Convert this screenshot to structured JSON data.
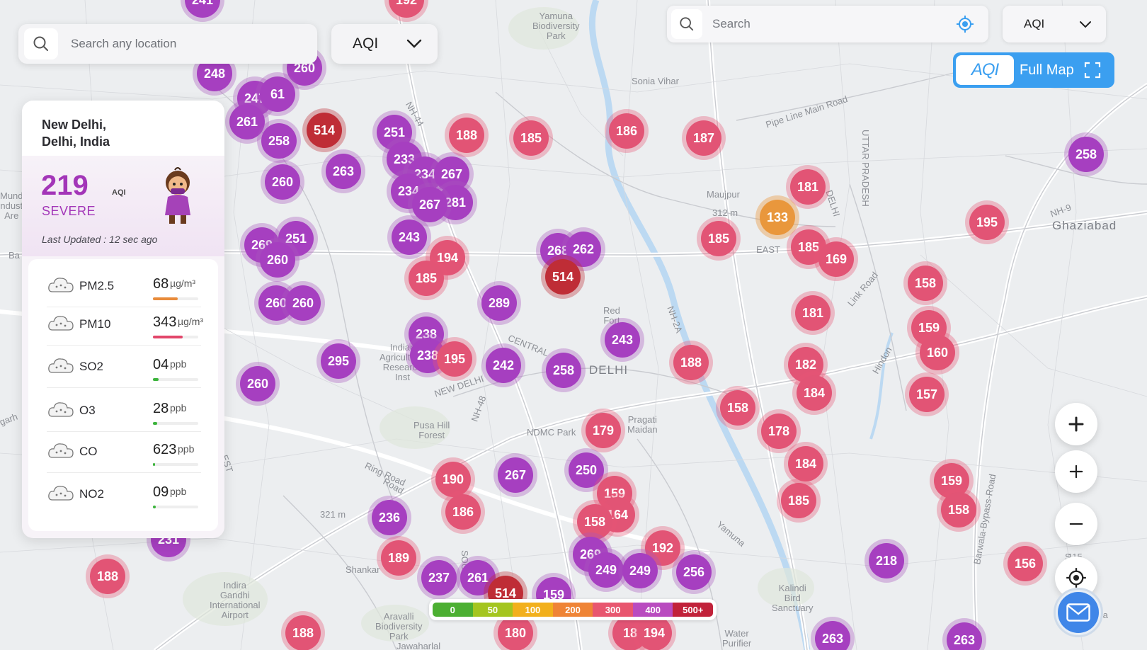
{
  "search": {
    "placeholder": "Search any location"
  },
  "selector": {
    "value": "AQI"
  },
  "location": {
    "line1": "New Delhi,",
    "line2": "Delhi, India"
  },
  "current": {
    "aqi": "219",
    "unit": "AQI",
    "level": "SEVERE",
    "updated": "Last Updated : 12 sec ago"
  },
  "pollutants": [
    {
      "name": "PM2.5",
      "value": "68",
      "unit": "µg/m³",
      "fill": 0.55,
      "color": "#e88b3a",
      "icon": "pm25-cloud-icon"
    },
    {
      "name": "PM10",
      "value": "343",
      "unit": "µg/m³",
      "fill": 0.65,
      "color": "#e2466a",
      "icon": "pm10-cloud-icon"
    },
    {
      "name": "SO2",
      "value": "04",
      "unit": "ppb",
      "fill": 0.12,
      "color": "#3cb43c",
      "icon": "so2-cloud-icon"
    },
    {
      "name": "O3",
      "value": "28",
      "unit": "ppb",
      "fill": 0.1,
      "color": "#3cb43c",
      "icon": "o3-cloud-icon"
    },
    {
      "name": "CO",
      "value": "623",
      "unit": "ppb",
      "fill": 0.04,
      "color": "#3cb43c",
      "icon": "co-cloud-icon"
    },
    {
      "name": "NO2",
      "value": "09",
      "unit": "ppb",
      "fill": 0.06,
      "color": "#3cb43c",
      "icon": "no2-cloud-icon"
    }
  ],
  "topright": {
    "search_placeholder": "Search",
    "selector": "AQI",
    "logo": "AQI",
    "fullmap": "Full Map"
  },
  "legend": [
    {
      "label": "0",
      "color": "#4caf32"
    },
    {
      "label": "50",
      "color": "#a4c51f"
    },
    {
      "label": "100",
      "color": "#f2b01c"
    },
    {
      "label": "200",
      "color": "#ef8436"
    },
    {
      "label": "300",
      "color": "#e8566f"
    },
    {
      "label": "400",
      "color": "#b94bbf"
    },
    {
      "label": "500+",
      "color": "#c1223a"
    }
  ],
  "places": [
    {
      "id": "yamuna",
      "text": "Yamuna\nBiodiversity\nPark"
    },
    {
      "id": "sonia",
      "text": "Sonia Vihar"
    },
    {
      "id": "pipeline",
      "text": "Pipe Line Main Road"
    },
    {
      "id": "maujpur",
      "text": "Maujpur"
    },
    {
      "id": "m312",
      "text": "312 m"
    },
    {
      "id": "east",
      "text": "EAST"
    },
    {
      "id": "ghaziabad",
      "text": "Ghaziabad"
    },
    {
      "id": "up",
      "text": "UTTAR PRADESH"
    },
    {
      "id": "delhi_r",
      "text": "DELHI"
    },
    {
      "id": "linkroad",
      "text": "Link Road"
    },
    {
      "id": "hindon",
      "text": "Hindon"
    },
    {
      "id": "redfort",
      "text": "Red\nFort"
    },
    {
      "id": "central",
      "text": "CENTRAL"
    },
    {
      "id": "delhi",
      "text": "DELHI"
    },
    {
      "id": "indian",
      "text": "Indian\nAgricultural\nResearch\nInst"
    },
    {
      "id": "newdel",
      "text": "NEW DELHI"
    },
    {
      "id": "pusa",
      "text": "Pusa Hill\nForest"
    },
    {
      "id": "ndmc",
      "text": "NDMC Park"
    },
    {
      "id": "pragati",
      "text": "Pragati\nMaidan"
    },
    {
      "id": "ringroad",
      "text": "Ring Road"
    },
    {
      "id": "m321",
      "text": "321 m"
    },
    {
      "id": "shankar",
      "text": "Shankar"
    },
    {
      "id": "igi",
      "text": "Indira\nGandhi\nInternational\nAirport"
    },
    {
      "id": "aravalli",
      "text": "Aravalli\nBiodiversity\nPark"
    },
    {
      "id": "jawaharlal",
      "text": "Jawaharlal"
    },
    {
      "id": "water",
      "text": "Water\nPurifier"
    },
    {
      "id": "kalindi",
      "text": "Kalindi\nBird\nSanctuary"
    },
    {
      "id": "yamuna_r",
      "text": "Yamuna"
    },
    {
      "id": "barwala",
      "text": "Barwala-Bypass-Road"
    },
    {
      "id": "n115",
      "text": "115"
    },
    {
      "id": "pura",
      "text": "lpura"
    },
    {
      "id": "mund",
      "text": "Mund\nndust\nAre"
    },
    {
      "id": "ba",
      "text": "Ba"
    },
    {
      "id": "garh",
      "text": "garh"
    },
    {
      "id": "est",
      "text": "EST"
    },
    {
      "id": "nh44",
      "text": "NH-44"
    },
    {
      "id": "nh48",
      "text": "NH-48"
    },
    {
      "id": "nh2a",
      "text": "NH-2A"
    },
    {
      "id": "nh9",
      "text": "NH-9"
    },
    {
      "id": "road",
      "text": "Road"
    },
    {
      "id": "south",
      "text": "SOUTH"
    },
    {
      "id": "s",
      "text": "S"
    }
  ],
  "markers": [
    {
      "v": "241",
      "c": "purple"
    },
    {
      "v": "192",
      "c": "pink"
    },
    {
      "v": "260",
      "c": "purple"
    },
    {
      "v": "248",
      "c": "purple"
    },
    {
      "v": "247",
      "c": "purple"
    },
    {
      "v": "61",
      "c": "purple"
    },
    {
      "v": "261",
      "c": "purple"
    },
    {
      "v": "258",
      "c": "purple"
    },
    {
      "v": "514",
      "c": "red"
    },
    {
      "v": "263",
      "c": "purple"
    },
    {
      "v": "260",
      "c": "purple"
    },
    {
      "v": "251",
      "c": "purple"
    },
    {
      "v": "233",
      "c": "purple"
    },
    {
      "v": "234",
      "c": "purple"
    },
    {
      "v": "267",
      "c": "purple"
    },
    {
      "v": "234",
      "c": "purple"
    },
    {
      "v": "281",
      "c": "purple"
    },
    {
      "v": "267",
      "c": "purple"
    },
    {
      "v": "188",
      "c": "pink"
    },
    {
      "v": "185",
      "c": "pink"
    },
    {
      "v": "186",
      "c": "pink"
    },
    {
      "v": "187",
      "c": "pink"
    },
    {
      "v": "243",
      "c": "purple"
    },
    {
      "v": "194",
      "c": "pink"
    },
    {
      "v": "185",
      "c": "pink"
    },
    {
      "v": "268",
      "c": "purple"
    },
    {
      "v": "262",
      "c": "purple"
    },
    {
      "v": "514",
      "c": "red"
    },
    {
      "v": "289",
      "c": "purple"
    },
    {
      "v": "269",
      "c": "purple"
    },
    {
      "v": "251",
      "c": "purple"
    },
    {
      "v": "260",
      "c": "purple"
    },
    {
      "v": "260",
      "c": "purple"
    },
    {
      "v": "260",
      "c": "purple"
    },
    {
      "v": "238",
      "c": "purple"
    },
    {
      "v": "238",
      "c": "purple"
    },
    {
      "v": "195",
      "c": "pink"
    },
    {
      "v": "242",
      "c": "purple"
    },
    {
      "v": "258",
      "c": "purple"
    },
    {
      "v": "243",
      "c": "purple"
    },
    {
      "v": "295",
      "c": "purple"
    },
    {
      "v": "260",
      "c": "purple"
    },
    {
      "v": "188",
      "c": "pink"
    },
    {
      "v": "181",
      "c": "pink"
    },
    {
      "v": "133",
      "c": "orange"
    },
    {
      "v": "185",
      "c": "pink"
    },
    {
      "v": "185",
      "c": "pink"
    },
    {
      "v": "169",
      "c": "pink"
    },
    {
      "v": "181",
      "c": "pink"
    },
    {
      "v": "182",
      "c": "pink"
    },
    {
      "v": "184",
      "c": "pink"
    },
    {
      "v": "158",
      "c": "pink"
    },
    {
      "v": "178",
      "c": "pink"
    },
    {
      "v": "179",
      "c": "pink"
    },
    {
      "v": "195",
      "c": "pink"
    },
    {
      "v": "258",
      "c": "purple"
    },
    {
      "v": "158",
      "c": "pink"
    },
    {
      "v": "159",
      "c": "pink"
    },
    {
      "v": "160",
      "c": "pink"
    },
    {
      "v": "157",
      "c": "pink"
    },
    {
      "v": "184",
      "c": "pink"
    },
    {
      "v": "185",
      "c": "pink"
    },
    {
      "v": "159",
      "c": "pink"
    },
    {
      "v": "158",
      "c": "pink"
    },
    {
      "v": "190",
      "c": "pink"
    },
    {
      "v": "267",
      "c": "purple"
    },
    {
      "v": "250",
      "c": "purple"
    },
    {
      "v": "159",
      "c": "pink"
    },
    {
      "v": "164",
      "c": "pink"
    },
    {
      "v": "158",
      "c": "pink"
    },
    {
      "v": "186",
      "c": "pink"
    },
    {
      "v": "236",
      "c": "purple"
    },
    {
      "v": "189",
      "c": "pink"
    },
    {
      "v": "192",
      "c": "pink"
    },
    {
      "v": "269",
      "c": "purple"
    },
    {
      "v": "249",
      "c": "purple"
    },
    {
      "v": "249",
      "c": "purple"
    },
    {
      "v": "256",
      "c": "purple"
    },
    {
      "v": "237",
      "c": "purple"
    },
    {
      "v": "261",
      "c": "purple"
    },
    {
      "v": "514",
      "c": "red"
    },
    {
      "v": "159",
      "c": "purple"
    },
    {
      "v": "231",
      "c": "purple"
    },
    {
      "v": "188",
      "c": "pink"
    },
    {
      "v": "218",
      "c": "purple"
    },
    {
      "v": "156",
      "c": "pink"
    },
    {
      "v": "188",
      "c": "pink"
    },
    {
      "v": "180",
      "c": "pink"
    },
    {
      "v": "18",
      "c": "pink"
    },
    {
      "v": "194",
      "c": "pink"
    },
    {
      "v": "263",
      "c": "purple"
    },
    {
      "v": "263",
      "c": "purple"
    }
  ]
}
